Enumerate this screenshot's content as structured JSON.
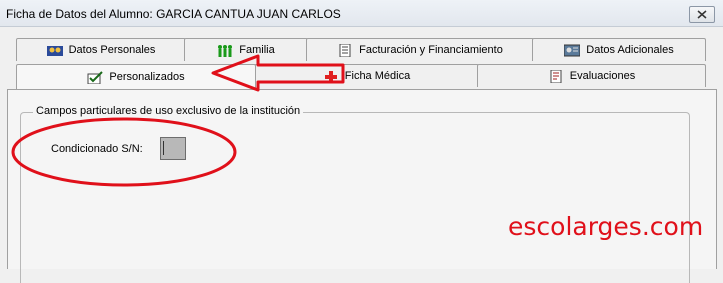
{
  "window": {
    "title": "Ficha de Datos del Alumno: GARCIA CANTUA JUAN CARLOS",
    "close_icon": "close-x-icon"
  },
  "tabs": {
    "row1": [
      {
        "label": "Datos Personales",
        "icon": "family-photo-icon"
      },
      {
        "label": "Familia",
        "icon": "people-icon"
      },
      {
        "label": "Facturación y Financiamiento",
        "icon": "document-icon"
      },
      {
        "label": "Datos Adicionales",
        "icon": "id-card-icon"
      }
    ],
    "row2": [
      {
        "label": "Personalizados",
        "icon": "checklist-icon",
        "active": true
      },
      {
        "label": "Ficha Médica",
        "icon": "medical-icon"
      },
      {
        "label": "Evaluaciones",
        "icon": "grades-icon"
      }
    ]
  },
  "group": {
    "title": "Campos particulares de uso exclusivo de la institución",
    "field_label": "Condicionado S/N:",
    "field_checked": false
  },
  "annotations": {
    "arrow_color": "#e0101a",
    "ellipse_color": "#e0101a"
  },
  "watermark": "escolarges.com"
}
